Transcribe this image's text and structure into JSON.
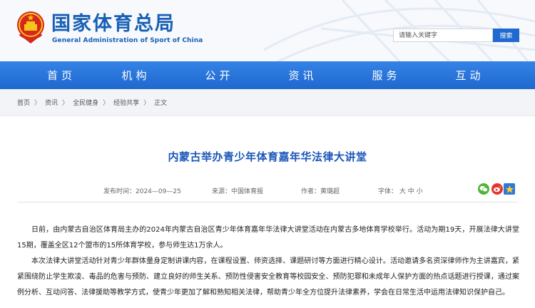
{
  "header": {
    "site_title": "国家体育总局",
    "site_subtitle": "General Administration of Sport of China",
    "search_placeholder": "请输入关键字",
    "search_button": "搜索"
  },
  "nav": {
    "items": [
      {
        "label": "首页"
      },
      {
        "label": "机构"
      },
      {
        "label": "公开"
      },
      {
        "label": "资讯"
      },
      {
        "label": "服务"
      },
      {
        "label": "互动"
      }
    ]
  },
  "breadcrumb": {
    "items": [
      "首页",
      "资讯",
      "全民健身",
      "经验共享",
      "正文"
    ],
    "separator": "〉"
  },
  "article": {
    "title": "内蒙古举办青少年体育嘉年华法律大讲堂",
    "published": "发布时间：2024—09—25",
    "source": "来源：中国体育报",
    "author": "作者：黄璐超",
    "font_size_label": "字体：",
    "font_size_large": "大",
    "font_size_medium": "中",
    "font_size_small": "小",
    "paragraphs": [
      "日前，由内蒙古自治区体育局主办的2024年内蒙古自治区青少年体育嘉年华法律大讲堂活动在内蒙古多地体育学校举行。活动为期19天，开展法律大讲堂15期，覆盖全区12个盟市的15所体育学校，参与师生达1万余人。",
      "本次法律大讲堂活动针对青少年群体量身定制讲课内容，在课程设置、师资选择、课题研讨等方面进行精心设计。活动邀请多名资深律师作为主讲嘉宾，紧紧围绕防止学生欺凌、毒品的危害与预防、建立良好的师生关系、预防性侵害安全教育等校园安全、预防犯罪和未成年人保护方面的热点话题进行授课，通过案例分析、互动问答、法律援助等教学方式，使青少年更加了解和熟知相关法律，帮助青少年全方位提升法律素养，学会在日常生活中运用法律知识保护自己。"
    ]
  },
  "share": {
    "wechat_icon": "wechat-icon",
    "weibo_icon": "weibo-icon",
    "qzone_icon": "qzone-star-icon"
  },
  "colors": {
    "brand_blue": "#1760b5",
    "nav_blue": "#2472d9",
    "title_blue": "#1a56b8"
  }
}
